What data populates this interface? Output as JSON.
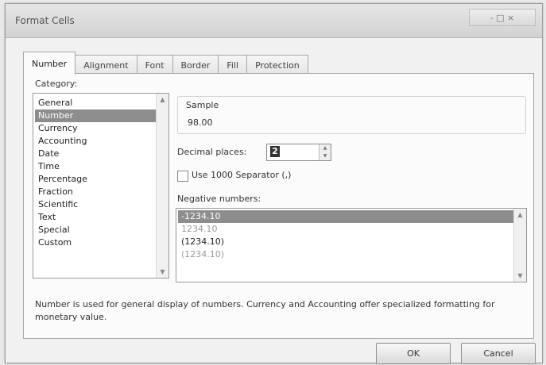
{
  "window": {
    "title": "Format Cells",
    "controls": "-   □   ×"
  },
  "tabs": [
    {
      "label": "Number",
      "active": true
    },
    {
      "label": "Alignment"
    },
    {
      "label": "Font"
    },
    {
      "label": "Border"
    },
    {
      "label": "Fill"
    },
    {
      "label": "Protection"
    }
  ],
  "category": {
    "label": "Category:",
    "items": [
      "General",
      "Number",
      "Currency",
      "Accounting",
      "Date",
      "Time",
      "Percentage",
      "Fraction",
      "Scientific",
      "Text",
      "Special",
      "Custom"
    ],
    "selected_index": 1
  },
  "sample": {
    "label": "Sample",
    "value": "98.00"
  },
  "decimal": {
    "label": "Decimal places:",
    "value": "2"
  },
  "separator": {
    "label": "Use 1000 Separator (,)",
    "checked": false
  },
  "negative": {
    "label": "Negative numbers:",
    "items": [
      "-1234.10",
      "1234.10",
      "(1234.10)",
      "(1234.10)"
    ],
    "selected_index": 0
  },
  "description": "Number is used for general display of numbers. Currency and Accounting offer specialized formatting for monetary value.",
  "buttons": {
    "ok": "OK",
    "cancel": "Cancel"
  }
}
